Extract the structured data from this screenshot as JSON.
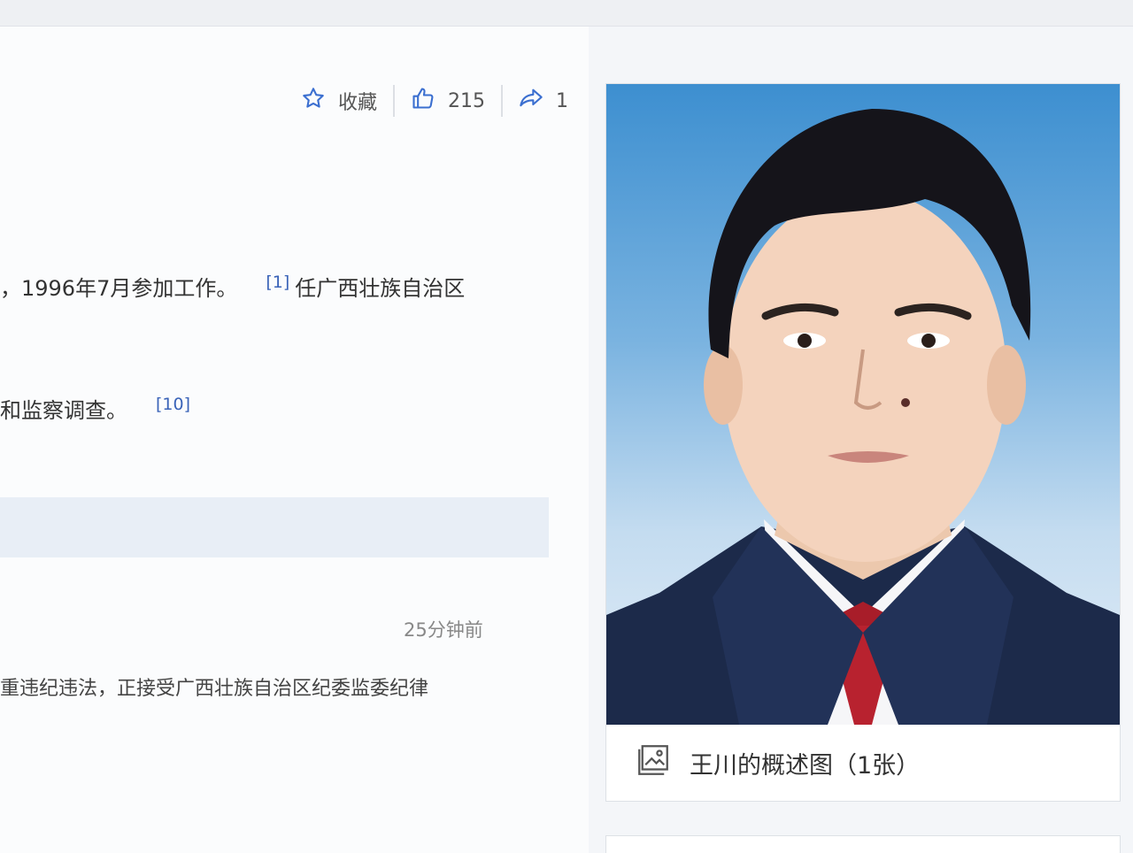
{
  "actions": {
    "favorite_label": "收藏",
    "like_count": "215",
    "share_count": "1"
  },
  "content": {
    "line1_text": "，1996年7月参加工作。",
    "line1_cite": "[1]",
    "line1_tail": "任广西壮族自治区",
    "line2_text": "和监察调查。",
    "line2_cite": "[10]"
  },
  "news": {
    "timestamp": "25分钟前",
    "text": "重违纪违法，正接受广西壮族自治区纪委监委纪律"
  },
  "photo_card": {
    "caption": "王川的概述图（1张）"
  },
  "icons": {
    "favorite": "star-outline-icon",
    "like": "thumbs-up-icon",
    "share": "share-arrow-icon",
    "gallery": "image-gallery-icon"
  },
  "colors": {
    "link": "#3a63b8",
    "icon_blue": "#3b6fd0"
  }
}
